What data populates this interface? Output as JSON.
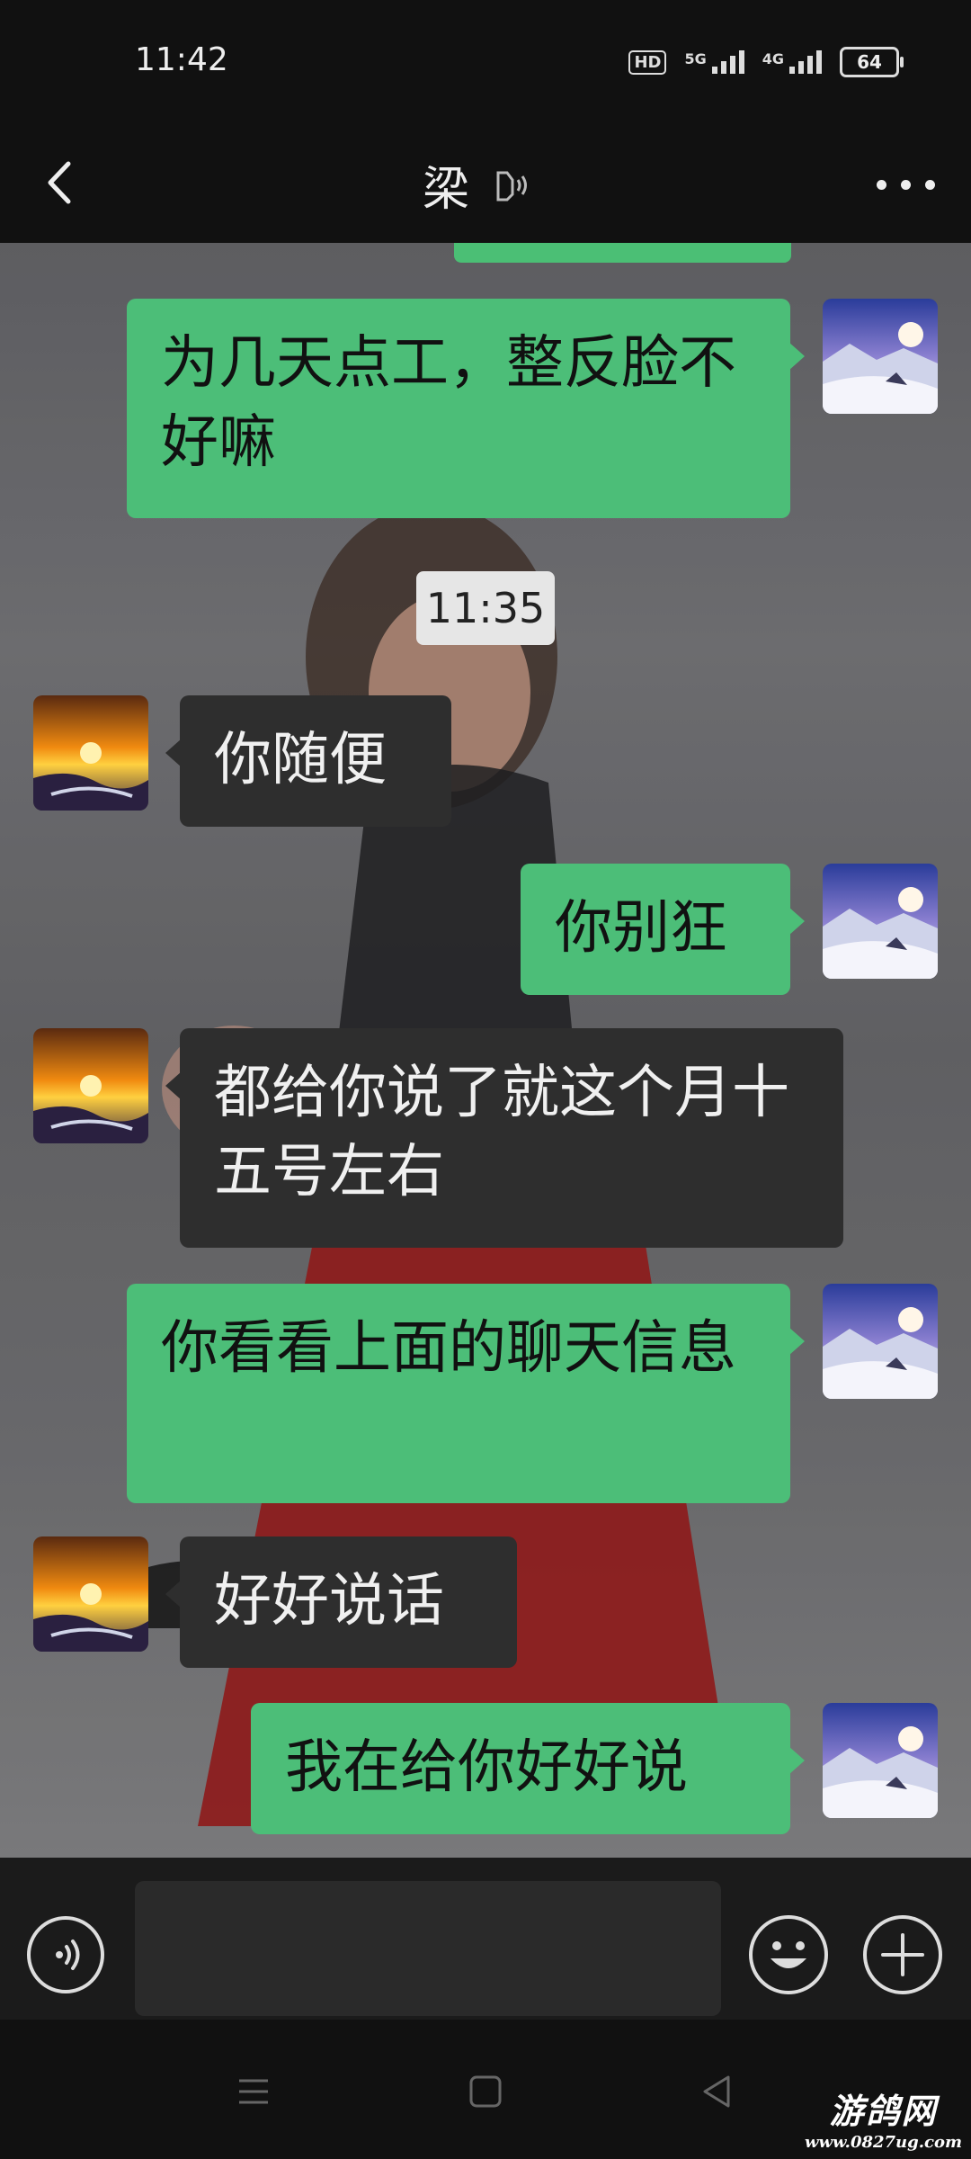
{
  "status_bar": {
    "time": "11:42",
    "hd": "HD",
    "net1": "5G",
    "net2": "4G",
    "battery": "64"
  },
  "header": {
    "title": "梁"
  },
  "chat": {
    "timestamp": "11:35",
    "messages": [
      {
        "from": "me",
        "text": "为几天点工，整反脸不好嘛"
      },
      {
        "from": "them",
        "text": "你随便"
      },
      {
        "from": "me",
        "text": "你别狂"
      },
      {
        "from": "them",
        "text": "都给你说了就这个月十五号左右"
      },
      {
        "from": "me",
        "text": "你看看上面的聊天信息"
      },
      {
        "from": "them",
        "text": "好好说话"
      },
      {
        "from": "me",
        "text": "我在给你好好说"
      }
    ]
  },
  "input": {
    "value": "",
    "placeholder": ""
  },
  "watermark": {
    "line1": "游鸽网",
    "line2": "www.0827ug.com"
  },
  "colors": {
    "my_bubble": "#4cbe78",
    "their_bubble": "#2e2e2e"
  }
}
